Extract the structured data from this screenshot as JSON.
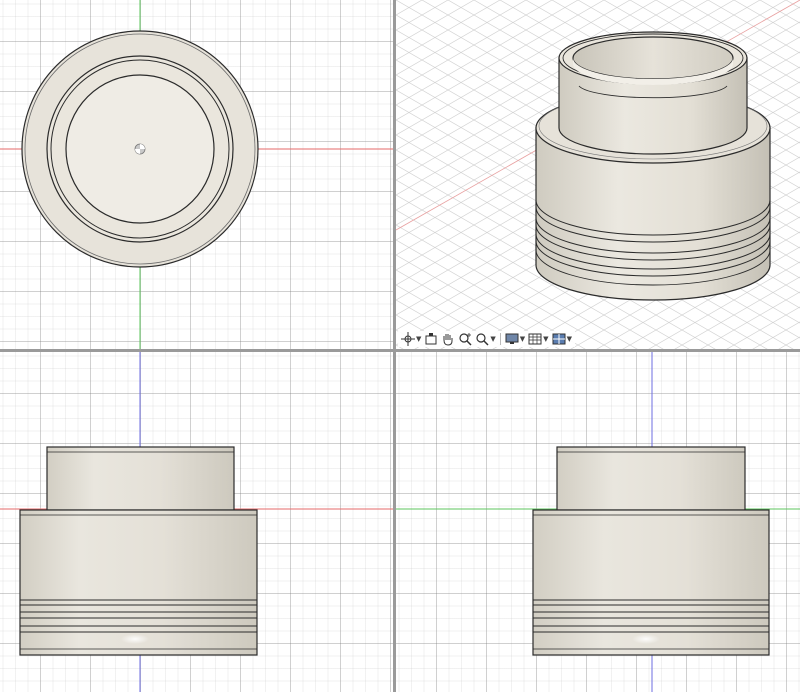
{
  "colors": {
    "body": "#e7e3da",
    "body_light": "#f0ede6",
    "body_shadow": "#cfcbc0",
    "edge": "#2b2b2b",
    "axis_red": "#e46a6a",
    "axis_green": "#5cc45c",
    "axis_blue": "#6d6de0",
    "grid": "#c9c9c9",
    "divider": "#9a9a9a"
  },
  "views": [
    {
      "id": "top",
      "label": ""
    },
    {
      "id": "isometric",
      "label": ""
    },
    {
      "id": "front",
      "label": ""
    },
    {
      "id": "right",
      "label": ""
    }
  ],
  "navigation_bar": {
    "items": [
      {
        "icon": "orbit-icon",
        "has_menu": true
      },
      {
        "icon": "look-at-icon",
        "has_menu": false
      },
      {
        "icon": "pan-hand-icon",
        "has_menu": false
      },
      {
        "icon": "zoom-icon",
        "has_menu": false
      },
      {
        "icon": "fit-zoom-icon",
        "has_menu": true
      },
      {
        "icon": "display-settings-icon",
        "has_menu": true
      },
      {
        "icon": "grid-snaps-icon",
        "has_menu": true
      },
      {
        "icon": "viewports-icon",
        "has_menu": true
      }
    ]
  }
}
